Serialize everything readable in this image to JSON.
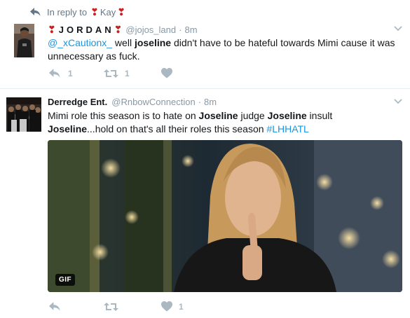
{
  "reply_context": {
    "prefix": "In reply to",
    "user": "Kay",
    "icon": "reply-arrow-icon"
  },
  "tweet1": {
    "display_name": "JORDAN",
    "name_decoration": "rose-emoji",
    "handle": "@jojos_land",
    "dot": "·",
    "time": "8m",
    "mention": "@_xCautionx_",
    "text_parts": [
      " well ",
      "joseline",
      " didn't have to be hateful towards Mimi cause it was unnecessary as fuck."
    ],
    "reply_count": "1",
    "retweet_count": "1",
    "like_count": ""
  },
  "tweet2": {
    "display_name": "Derredge Ent.",
    "handle": "@RnbowConnection",
    "dot": "·",
    "time": "8m",
    "text_parts": [
      "Mimi role this season is to hate on ",
      "Joseline",
      " judge ",
      "Joseline",
      " insult ",
      "Joseline",
      "...hold on that's all their roles this season "
    ],
    "hashtag": "#LHHATL",
    "media_badge": "GIF",
    "reply_count": "",
    "retweet_count": "",
    "like_count": "1"
  },
  "colors": {
    "link": "#1b95e0",
    "muted": "#8899a6",
    "icon": "#aab8c2",
    "text": "#14171a"
  }
}
